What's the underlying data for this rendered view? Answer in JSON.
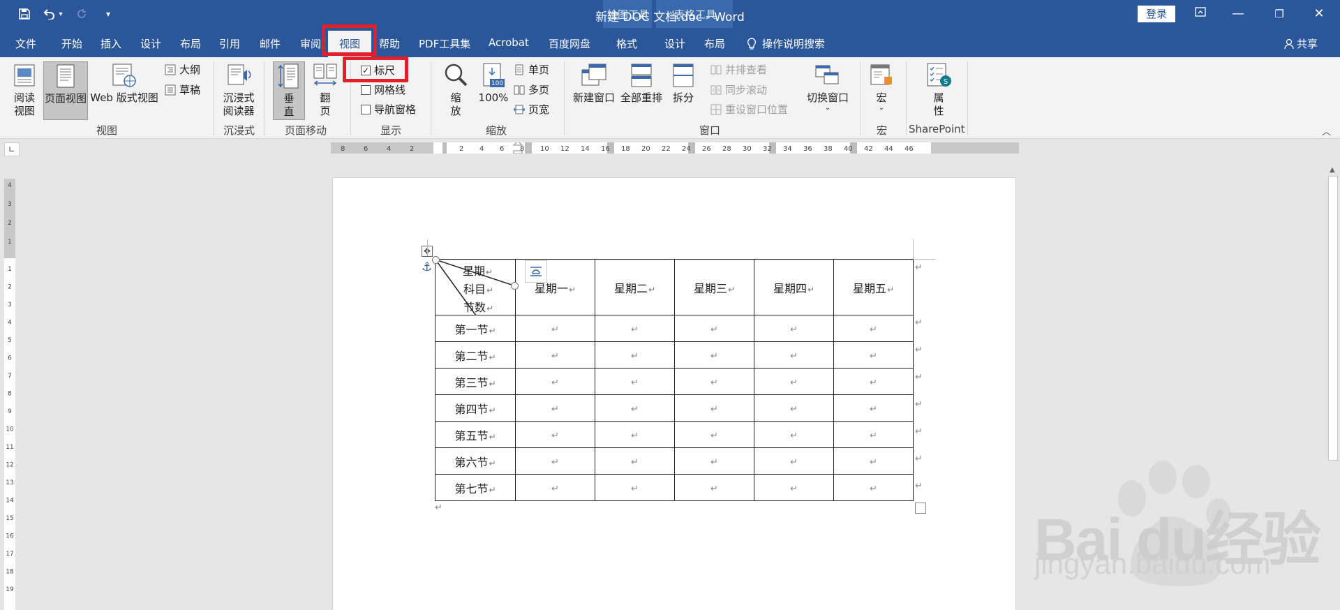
{
  "window": {
    "title": "新建 DOC 文档.doc  -  Word",
    "context_groups": [
      "绘图工具",
      "表格工具"
    ],
    "login": "登录",
    "share": "共享",
    "tell_me": "操作说明搜索"
  },
  "tabs": {
    "file": "文件",
    "home": "开始",
    "insert": "插入",
    "design": "设计",
    "layout": "布局",
    "references": "引用",
    "mailings": "邮件",
    "review": "审阅",
    "view": "视图",
    "help": "帮助",
    "pdf": "PDF工具集",
    "acrobat": "Acrobat",
    "baidu": "百度网盘",
    "format": "格式",
    "table_design": "设计",
    "table_layout": "布局"
  },
  "ribbon": {
    "views": {
      "group": "视图",
      "read_mode": [
        "阅读",
        "视图"
      ],
      "print_layout": "页面视图",
      "web_layout": "Web 版式视图",
      "outline": "大纲",
      "draft": "草稿"
    },
    "immersive": {
      "group": "沉浸式",
      "reader": [
        "沉浸式",
        "阅读器"
      ]
    },
    "page_move": {
      "group": "页面移动",
      "vertical": [
        "垂",
        "直"
      ],
      "side": [
        "翻",
        "页"
      ]
    },
    "show": {
      "group": "显示",
      "ruler": "标尺",
      "ruler_checked": "✓",
      "gridlines": "网格线",
      "nav_pane": "导航窗格"
    },
    "zoom": {
      "group": "缩放",
      "zoom": [
        "缩",
        "放"
      ],
      "percent": "100%",
      "percent_badge": "100",
      "one_page": "单页",
      "multi_page": "多页",
      "page_width": "页宽"
    },
    "window": {
      "group": "窗口",
      "new_window": "新建窗口",
      "arrange_all": "全部重排",
      "split": "拆分",
      "side_by_side": "并排查看",
      "sync_scroll": "同步滚动",
      "reset_pos": "重设窗口位置",
      "switch": "切换窗口"
    },
    "macros": {
      "group": "宏",
      "macro": "宏"
    },
    "sharepoint": {
      "group": "SharePoint",
      "props": [
        "属",
        "性"
      ]
    }
  },
  "rulers": {
    "h_left": [
      "8",
      "6",
      "4",
      "2"
    ],
    "h_right": [
      "2",
      "4",
      "6",
      "8",
      "10",
      "12",
      "14",
      "16",
      "18",
      "20",
      "22",
      "24",
      "26",
      "28",
      "30",
      "32",
      "34",
      "36",
      "38",
      "40",
      "42",
      "44",
      "46"
    ],
    "v_top": [
      "4",
      "3",
      "2",
      "1"
    ],
    "v_bottom": [
      "1",
      "2",
      "3",
      "4",
      "5",
      "6",
      "7",
      "8",
      "9",
      "10",
      "11",
      "12",
      "13",
      "14",
      "15",
      "16",
      "17",
      "18",
      "19"
    ]
  },
  "table": {
    "corner": {
      "top": "星期",
      "mid": "科目",
      "bottom": "节数"
    },
    "days": [
      "星期一",
      "星期二",
      "星期三",
      "星期四",
      "星期五"
    ],
    "periods": [
      "第一节",
      "第二节",
      "第三节",
      "第四节",
      "第五节",
      "第六节",
      "第七节"
    ],
    "mark": "↵"
  },
  "watermark": {
    "brand": "Bai  du经验",
    "url": "jingyan.baidu.com"
  },
  "colors": {
    "title_bar": "#2b579a",
    "ribbon": "#f3f3f3",
    "highlight": "#e0202a"
  }
}
